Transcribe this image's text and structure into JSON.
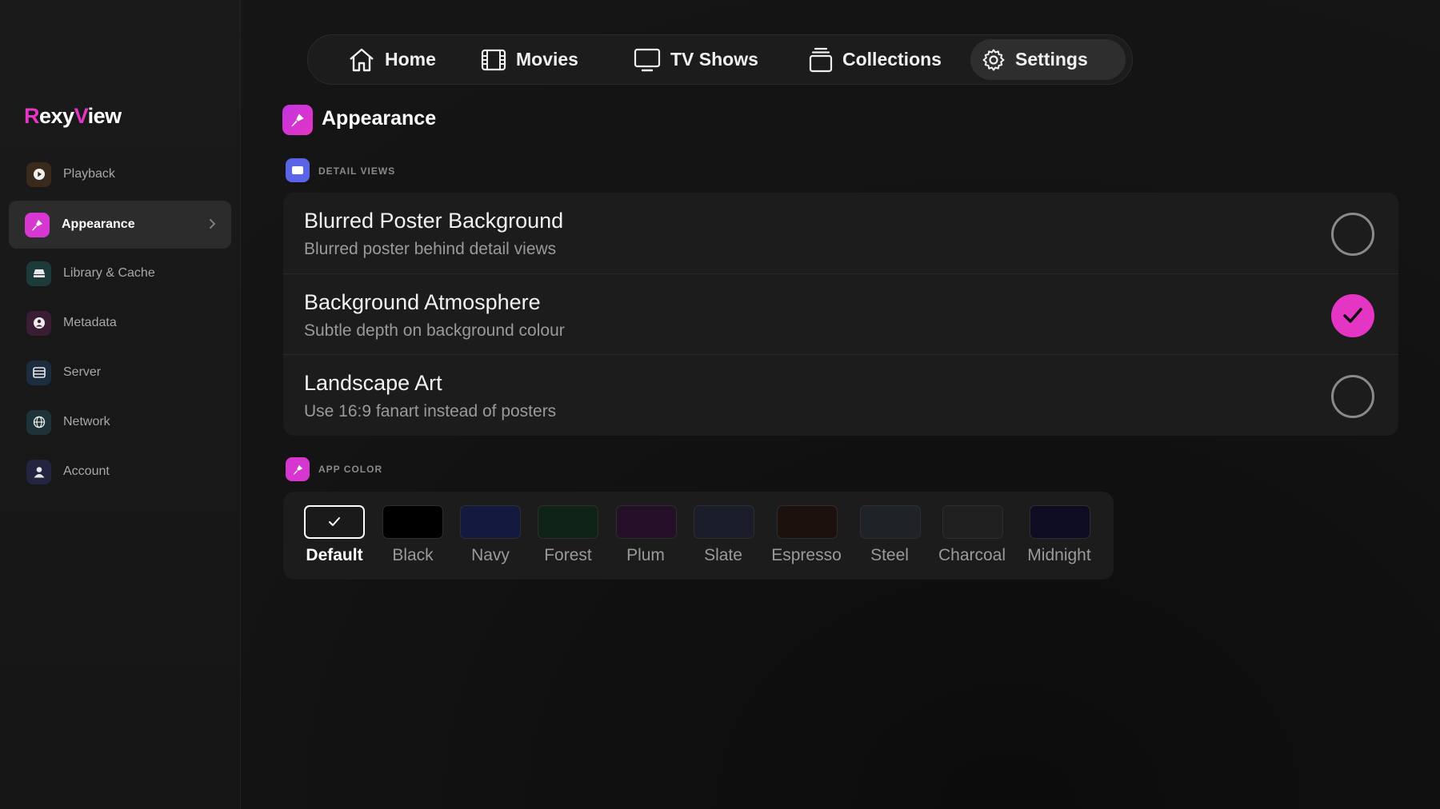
{
  "app": {
    "logo_first": "R",
    "logo_mid1": "exy",
    "logo_accent": "V",
    "logo_rest": "iew"
  },
  "nav": {
    "items": [
      {
        "label": "Home",
        "icon": "home-icon"
      },
      {
        "label": "Movies",
        "icon": "film-icon"
      },
      {
        "label": "TV Shows",
        "icon": "tv-icon"
      },
      {
        "label": "Collections",
        "icon": "collections-icon"
      },
      {
        "label": "Settings",
        "icon": "gear-icon",
        "active": true
      }
    ]
  },
  "sidebar": {
    "items": [
      {
        "label": "Playback",
        "icon": "play-icon",
        "color": "#3a2a1c"
      },
      {
        "label": "Appearance",
        "icon": "brush-icon",
        "color": "#d637d0",
        "active": true
      },
      {
        "label": "Library & Cache",
        "icon": "drive-icon",
        "color": "#1d3a3a"
      },
      {
        "label": "Metadata",
        "icon": "info-icon",
        "color": "#3a1d33"
      },
      {
        "label": "Server",
        "icon": "server-icon",
        "color": "#1c2d40"
      },
      {
        "label": "Network",
        "icon": "globe-icon",
        "color": "#1d3338"
      },
      {
        "label": "Account",
        "icon": "user-icon",
        "color": "#23243f"
      }
    ]
  },
  "page": {
    "title": "Appearance"
  },
  "detail_views": {
    "header": "DETAIL VIEWS",
    "options": [
      {
        "title": "Blurred Poster Background",
        "subtitle": "Blurred poster behind detail views",
        "checked": false
      },
      {
        "title": "Background Atmosphere",
        "subtitle": "Subtle depth on background colour",
        "checked": true
      },
      {
        "title": "Landscape Art",
        "subtitle": "Use 16:9 fanart instead of posters",
        "checked": false
      }
    ]
  },
  "app_color": {
    "header": "APP COLOR",
    "swatches": [
      {
        "label": "Default",
        "color": "#1a1a1a",
        "selected": true
      },
      {
        "label": "Black",
        "color": "#000000"
      },
      {
        "label": "Navy",
        "color": "#141a3f"
      },
      {
        "label": "Forest",
        "color": "#0f2416"
      },
      {
        "label": "Plum",
        "color": "#250f28"
      },
      {
        "label": "Slate",
        "color": "#1b1e2a"
      },
      {
        "label": "Espresso",
        "color": "#1d110e"
      },
      {
        "label": "Steel",
        "color": "#1f2226"
      },
      {
        "label": "Charcoal",
        "color": "#202020"
      },
      {
        "label": "Midnight",
        "color": "#0e0c22"
      }
    ]
  },
  "colors": {
    "accent": "#e535c4",
    "detail_views_icon": "#5b63e6"
  }
}
